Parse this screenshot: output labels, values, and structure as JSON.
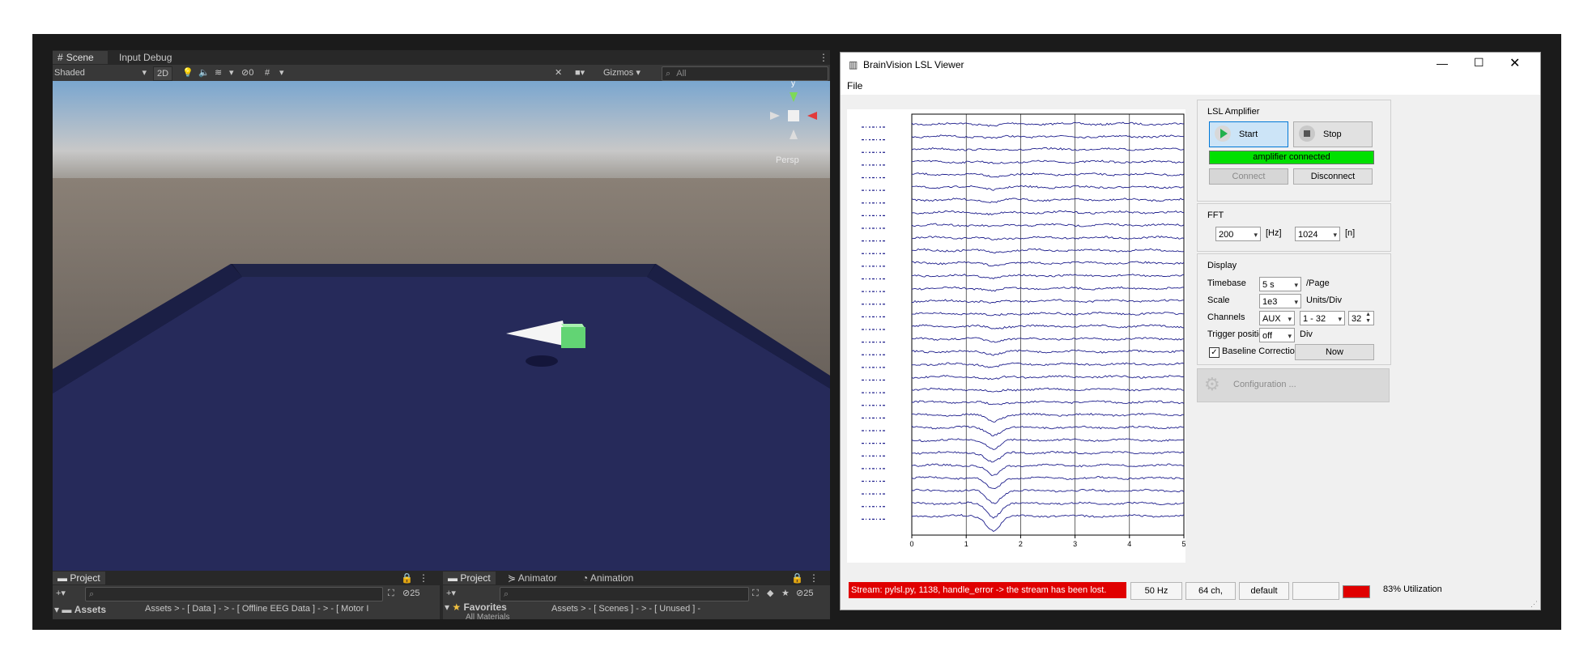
{
  "unity": {
    "tabs": [
      "Scene",
      "Input Debug"
    ],
    "toolbar": {
      "shading": "Shaded",
      "mode_2d": "2D",
      "hidden_count": "0",
      "gizmos": "Gizmos",
      "search_placeholder": "All"
    },
    "gizmo": {
      "y_label": "y",
      "persp_label": "Persp"
    },
    "bottom_left": {
      "tab": "Project",
      "hidden_count": "25",
      "assets_label": "Assets",
      "breadcrumb": "Assets > - [ Data ] - > - [ Offline EEG Data ] - > - [ Motor I"
    },
    "bottom_right": {
      "tabs": [
        "Project",
        "Animator",
        "Animation"
      ],
      "hidden_count": "25",
      "favorites_label": "Favorites",
      "favorites_item": "All Materials",
      "breadcrumb": "Assets > - [ Scenes ] - > - [ Unused ] -"
    }
  },
  "bv": {
    "title": "BrainVision LSL Viewer",
    "menu": "File",
    "lsl_group": "LSL Amplifier",
    "start": "Start",
    "stop": "Stop",
    "connection_status": "amplifier connected",
    "connect": "Connect",
    "disconnect": "Disconnect",
    "fft_group": "FFT",
    "fft_rate": "200",
    "fft_rate_unit": "[Hz]",
    "fft_n": "1024",
    "fft_n_unit": "[n]",
    "display_group": "Display",
    "timebase_label": "Timebase",
    "timebase_value": "5 s",
    "timebase_unit": "/Page",
    "scale_label": "Scale",
    "scale_value": "1e3",
    "scale_unit": "Units/Div",
    "channels_label": "Channels",
    "channels_type": "AUX",
    "channels_range": "1 - 32",
    "channels_count": "32",
    "trigger_label": "Trigger position",
    "trigger_value": "off",
    "trigger_unit": "Div",
    "baseline_label": "Baseline Correction",
    "now": "Now",
    "config": "Configuration ...",
    "status": {
      "error": "Stream: pylsl.py, 1138, handle_error -> the stream has been lost.",
      "rate": "50 Hz",
      "channels": "64 ch,",
      "profile": "default",
      "utilization": "83% Utilization"
    },
    "x_ticks": [
      "0",
      "1",
      "2",
      "3",
      "4",
      "5"
    ],
    "colors": {
      "trace": "#1e1e8c",
      "status_ok": "#00e000",
      "status_err": "#e00000"
    }
  },
  "chart_data": {
    "type": "line",
    "title": "",
    "xlabel": "",
    "ylabel": "",
    "xlim": [
      0,
      5
    ],
    "x_ticks": [
      0,
      1,
      2,
      3,
      4,
      5
    ],
    "n_traces": 32,
    "event_time": 1.5
  }
}
